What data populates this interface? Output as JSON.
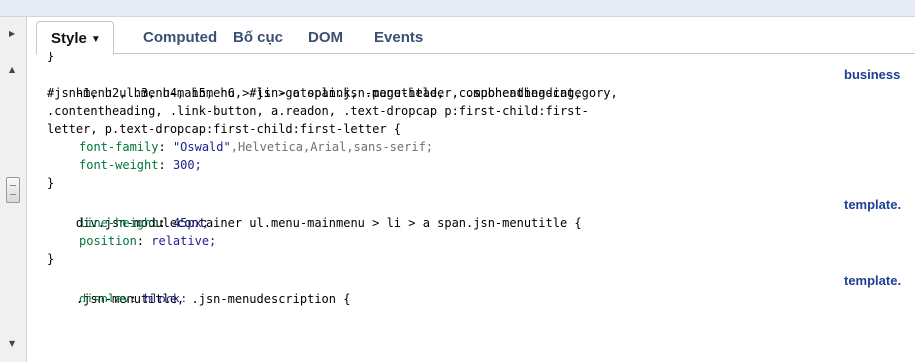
{
  "tabs": [
    {
      "label": "Style",
      "active": true
    },
    {
      "label": "Computed",
      "active": false
    },
    {
      "label": "Bố cục",
      "active": false
    },
    {
      "label": "DOM",
      "active": false
    },
    {
      "label": "Events",
      "active": false
    }
  ],
  "code": {
    "prev_close": "}",
    "rule1": {
      "selector_lines": [
        "h1, h2, h3, h4, h5, h6, #jsn-gotoplink, .page-header, .subheading-category,",
        "#jsn-menu ul.menu-mainmenu > li > a span.jsn-menutitle, .componentheading,",
        ".contentheading, .link-button, a.readon, .text-dropcap p:first-child:first-",
        "letter, p.text-dropcap:first-child:first-letter {"
      ],
      "source": "business",
      "props": [
        {
          "name": "font-family",
          "value": "\"Oswald\"",
          "value_rest": ",Helvetica,Arial,sans-serif;"
        },
        {
          "name": "font-weight",
          "value": "300;"
        }
      ],
      "close": "}"
    },
    "rule2": {
      "selector": "div.jsn-modulecontainer ul.menu-mainmenu > li > a span.jsn-menutitle {",
      "source": "template.",
      "props": [
        {
          "name": "line-height",
          "value": "45px;"
        },
        {
          "name": "position",
          "value": "relative;"
        }
      ],
      "close": "}"
    },
    "rule3": {
      "selector": ".jsn-menutitle, .jsn-menudescription {",
      "source": "template.",
      "props": [
        {
          "name": "display",
          "value": "block;"
        }
      ]
    }
  },
  "icons": {
    "expander": "triangle-right-icon",
    "scroll_up": "triangle-up-icon",
    "scroll_down": "triangle-down-icon",
    "tab_caret": "caret-down-icon"
  },
  "colors": {
    "property_name": "#00753b",
    "property_value": "#1d1d8f",
    "source_link": "#1f3e97",
    "tab_text": "#3b4f73"
  }
}
